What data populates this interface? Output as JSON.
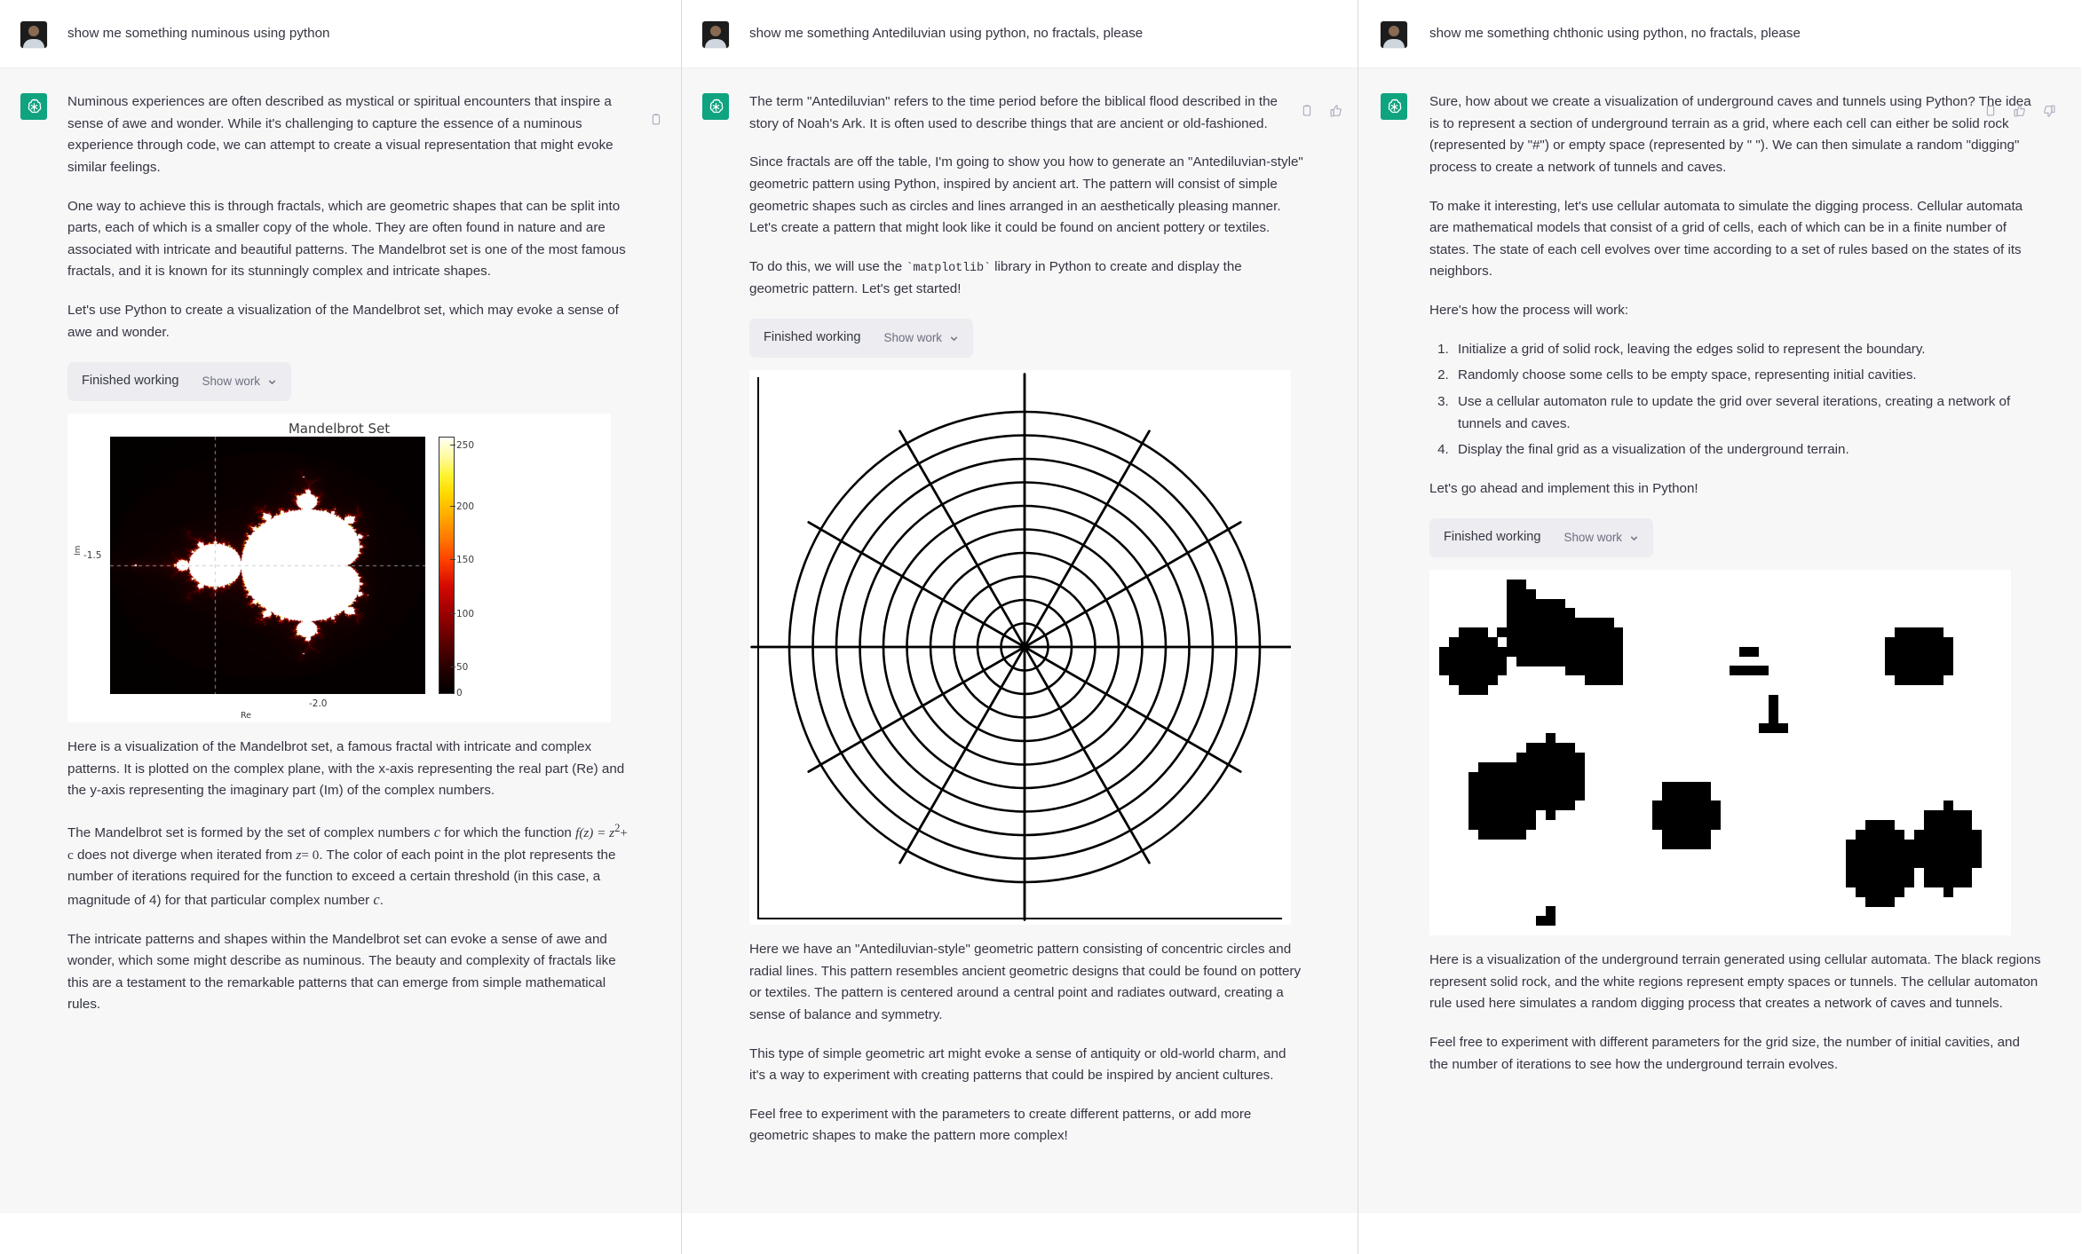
{
  "columns": [
    {
      "id": "numinous",
      "user": {
        "prompt": "show me something numinous using python"
      },
      "assistant": {
        "paragraphs": [
          "Numinous experiences are often described as mystical or spiritual encounters that inspire a sense of awe and wonder. While it's challenging to capture the essence of a numinous experience through code, we can attempt to create a visual representation that might evoke similar feelings.",
          "One way to achieve this is through fractals, which are geometric shapes that can be split into parts, each of which is a smaller copy of the whole. They are often found in nature and are associated with intricate and beautiful patterns. The Mandelbrot set is one of the most famous fractals, and it is known for its stunningly complex and intricate shapes.",
          "Let's use Python to create a visualization of the Mandelbrot set, which may evoke a sense of awe and wonder."
        ],
        "tool": {
          "title": "Finished working",
          "show_work": "Show work"
        },
        "after_paragraphs": [
          "Here is a visualization of the Mandelbrot set, a famous fractal with intricate and complex patterns. It is plotted on the complex plane, with the x-axis representing the real part (Re) and the y-axis representing the imaginary part (Im) of the complex numbers.",
          "The Mandelbrot set is formed by the set of complex numbers c for which the function f(z) = z^2 + c does not diverge when iterated from z = 0. The color of each point in the plot represents the number of iterations required for the function to exceed a certain threshold (in this case, a magnitude of 4) for that particular complex number c.",
          "The intricate patterns and shapes within the Mandelbrot set can evoke a sense of awe and wonder, which some might describe as numinous. The beauty and complexity of fractals like this are a testament to the remarkable patterns that can emerge from simple mathematical rules."
        ],
        "math_fragments": {
          "c1": "c",
          "fz": "f(z) = z",
          "exp": "2",
          "plusc": "+ c",
          "z0a": "z",
          "z0b": "= 0",
          "c2": "c"
        },
        "actions": [
          "copy-icon"
        ]
      }
    },
    {
      "id": "antediluvian",
      "user": {
        "prompt": "show me something Antediluvian using python, no fractals, please"
      },
      "assistant": {
        "paragraphs": [
          "The term \"Antediluvian\" refers to the time period before the biblical flood described in the story of Noah's Ark. It is often used to describe things that are ancient or old-fashioned.",
          "Since fractals are off the table, I'm going to show you how to generate an \"Antediluvian-style\" geometric pattern using Python, inspired by ancient art. The pattern will consist of simple geometric shapes such as circles and lines arranged in an aesthetically pleasing manner. Let's create a pattern that might look like it could be found on ancient pottery or textiles."
        ],
        "code_sentence": {
          "before": "To do this, we will use the ",
          "code": "`matplotlib`",
          "after": " library in Python to create and display the geometric pattern. Let's get started!"
        },
        "tool": {
          "title": "Finished working",
          "show_work": "Show work"
        },
        "after_paragraphs": [
          "Here we have an \"Antediluvian-style\" geometric pattern consisting of concentric circles and radial lines. This pattern resembles ancient geometric designs that could be found on pottery or textiles. The pattern is centered around a central point and radiates outward, creating a sense of balance and symmetry.",
          "This type of simple geometric art might evoke a sense of antiquity or old-world charm, and it's a way to experiment with creating patterns that could be inspired by ancient cultures.",
          "Feel free to experiment with the parameters to create different patterns, or add more geometric shapes to make the pattern more complex!"
        ],
        "actions": [
          "copy-icon",
          "thumbs-up-icon"
        ]
      }
    },
    {
      "id": "chthonic",
      "user": {
        "prompt": "show me something chthonic using python, no fractals, please"
      },
      "assistant": {
        "paragraphs": [
          "Sure, how about we create a visualization of underground caves and tunnels using Python? The idea is to represent a section of underground terrain as a grid, where each cell can either be solid rock (represented by \"#\") or empty space (represented by \" \"). We can then simulate a random \"digging\" process to create a network of tunnels and caves.",
          "To make it interesting, let's use cellular automata to simulate the digging process. Cellular automata are mathematical models that consist of a grid of cells, each of which can be in a finite number of states. The state of each cell evolves over time according to a set of rules based on the states of its neighbors.",
          "Here's how the process will work:"
        ],
        "steps": [
          "Initialize a grid of solid rock, leaving the edges solid to represent the boundary.",
          "Randomly choose some cells to be empty space, representing initial cavities.",
          "Use a cellular automaton rule to update the grid over several iterations, creating a network of tunnels and caves.",
          "Display the final grid as a visualization of the underground terrain."
        ],
        "implement_line": "Let's go ahead and implement this in Python!",
        "tool": {
          "title": "Finished working",
          "show_work": "Show work"
        },
        "after_paragraphs": [
          "Here is a visualization of the underground terrain generated using cellular automata. The black regions represent solid rock, and the white regions represent empty spaces or tunnels. The cellular automaton rule used here simulates a random digging process that creates a network of caves and tunnels.",
          "Feel free to experiment with different parameters for the grid size, the number of initial cavities, and the number of iterations to see how the underground terrain evolves."
        ],
        "actions": [
          "copy-icon",
          "thumbs-up-icon",
          "thumbs-down-icon"
        ]
      }
    }
  ],
  "chart_data": [
    {
      "type": "heatmap",
      "title": "Mandelbrot Set",
      "xlabel": "Re",
      "ylabel": "Im",
      "xticks": [
        "-2.0"
      ],
      "yticks": [
        "-1.5"
      ],
      "colorbar_ticks": [
        0,
        50,
        100,
        150,
        200,
        250
      ],
      "colormap": "hot",
      "vmin": 0,
      "vmax": 256,
      "xlim": [
        -2.0,
        1.0
      ],
      "ylim": [
        -1.5,
        1.5
      ],
      "grid": true
    },
    {
      "type": "line",
      "title": "",
      "description": "Antediluvian-style polar pattern: concentric circles and radial lines",
      "num_circles": 10,
      "num_radial_lines": 12,
      "radii": [
        0.1,
        0.2,
        0.3,
        0.4,
        0.5,
        0.6,
        0.7,
        0.8,
        0.9,
        1.0
      ],
      "line_color": "#000000",
      "background": "#ffffff",
      "grid": false
    },
    {
      "type": "heatmap",
      "title": "",
      "description": "Cellular automata underground cave map; black = solid rock, white = empty space",
      "grid_cols": 60,
      "grid_rows": 38,
      "colors": {
        "rock": "#000000",
        "empty": "#ffffff"
      },
      "grid": false
    }
  ]
}
